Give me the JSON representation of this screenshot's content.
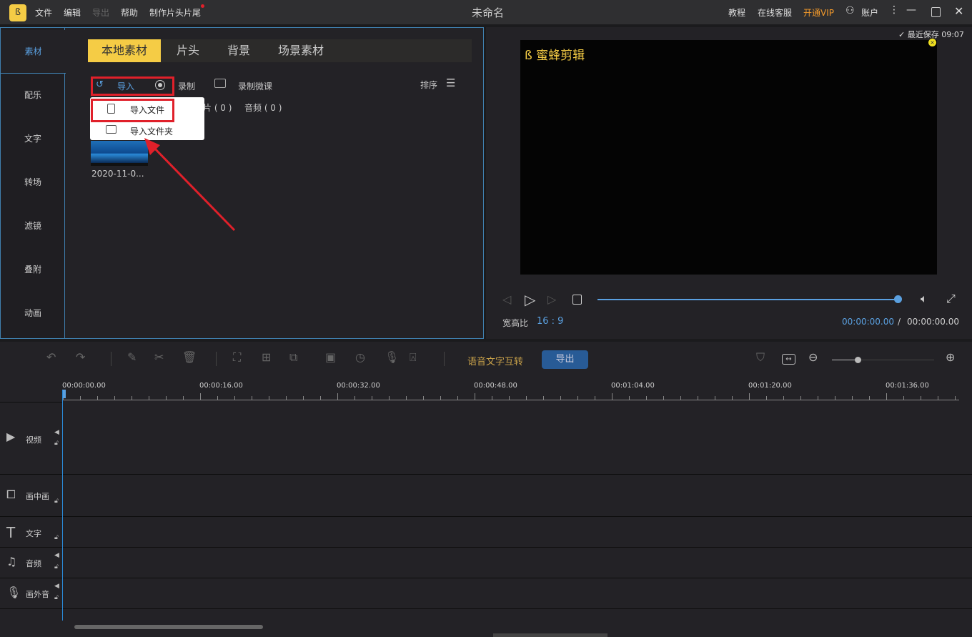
{
  "titlebar": {
    "title": "未命名",
    "menu": [
      "文件",
      "编辑",
      "导出",
      "帮助",
      "制作片头片尾"
    ],
    "right": {
      "tutorial": "教程",
      "service": "在线客服",
      "vip": "开通VIP",
      "account": "账户"
    }
  },
  "sidebar": {
    "items": [
      "素材",
      "配乐",
      "文字",
      "转场",
      "滤镜",
      "叠附",
      "动画"
    ],
    "active": "素材"
  },
  "tabs": [
    "本地素材",
    "片头",
    "背景",
    "场景素材"
  ],
  "toolbar": {
    "import": "导入",
    "record": "录制",
    "record_course": "录制微课",
    "sort": "排序"
  },
  "filters": {
    "partial": "片 ( 0 )",
    "audio": "音频 ( 0 )"
  },
  "dropdown": {
    "items": [
      "导入文件",
      "导入文件夹"
    ]
  },
  "media": [
    {
      "name": "2020-11-0..."
    }
  ],
  "preview": {
    "saved": "最近保存 09:07",
    "watermark": "蜜蜂剪辑",
    "aspect_label": "宽高比",
    "aspect": "16 : 9",
    "current_time": "00:00:00.00",
    "total_time": "00:00:00.00",
    "separator": "/",
    "progress": 1.0
  },
  "timeline": {
    "speech_to_text": "语音文字互转",
    "export": "导出",
    "zoom_level": 0.25,
    "ruler": [
      "00:00:00.00",
      "00:00:16.00",
      "00:00:32.00",
      "00:00:48.00",
      "00:01:04.00",
      "00:01:20.00",
      "00:01:36.00"
    ],
    "tracks": [
      "视频",
      "画中画",
      "文字",
      "音频",
      "画外音"
    ]
  },
  "colors": {
    "accent": "#5aa0e0",
    "tab_active": "#f5cc45",
    "vip": "#f39a2b",
    "export_button": "#285b96",
    "annotation": "#e0202a"
  }
}
